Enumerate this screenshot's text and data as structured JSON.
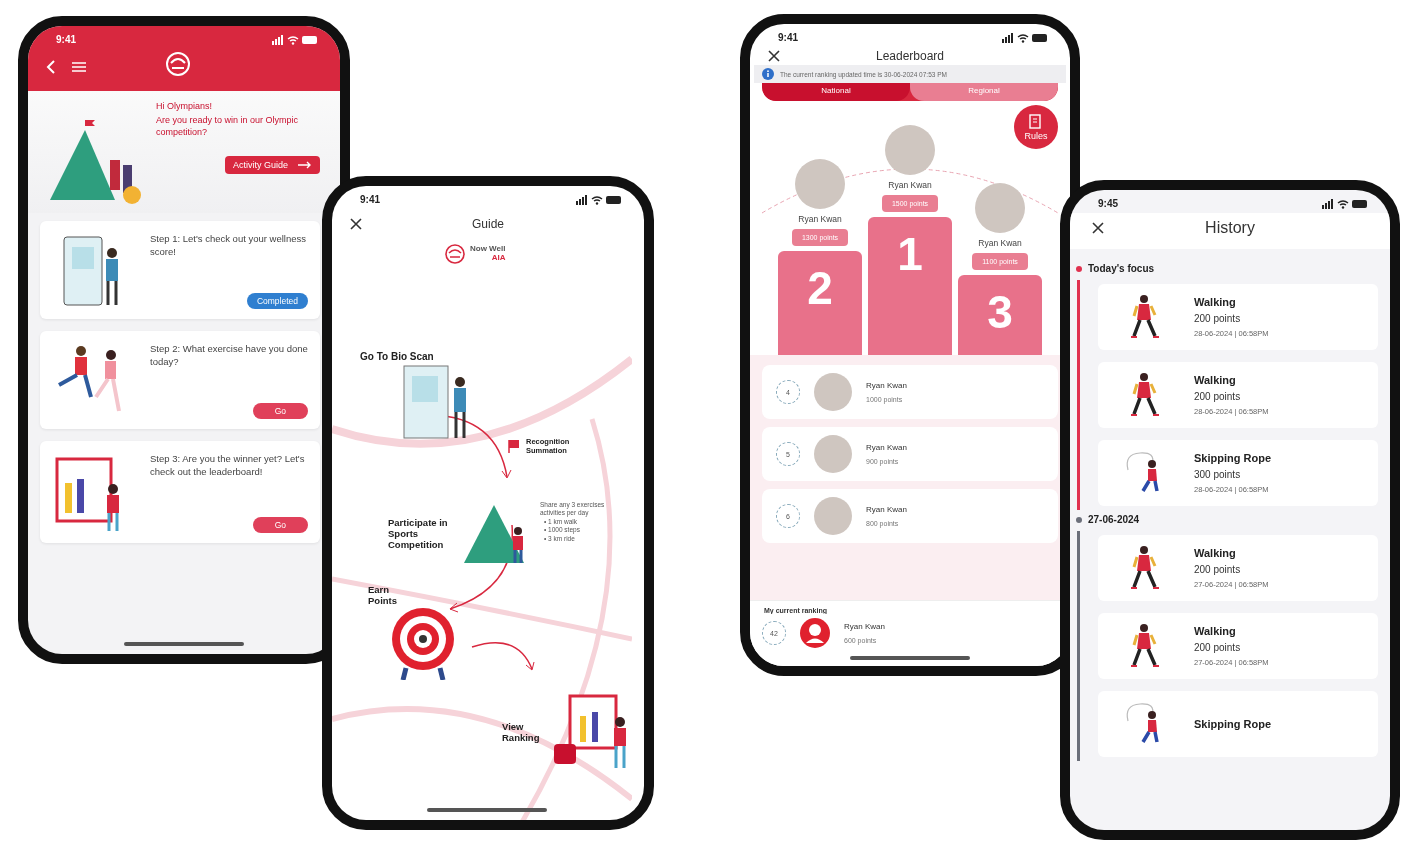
{
  "home": {
    "time": "9:41",
    "greeting": "Hi Olympians!",
    "prompt": "Are you ready to win in our Olympic competition?",
    "guide_button": "Activity Guide",
    "steps": [
      {
        "text": "Step 1: Let's check out your wellness score!",
        "button": "Completed",
        "completed": true,
        "kind": "scan"
      },
      {
        "text": "Step 2: What exercise have you done today?",
        "button": "Go",
        "completed": false,
        "kind": "run"
      },
      {
        "text": "Step 3: Are you the winner yet? Let's check out the leaderboard!",
        "button": "Go",
        "completed": false,
        "kind": "board"
      }
    ]
  },
  "guide": {
    "time": "9:41",
    "title": "Guide",
    "logo_text": "Now Well",
    "logo_sub": "AIA",
    "stages": [
      {
        "label": "Go To Bio Scan",
        "kind": "scan"
      },
      {
        "label": "Recognition Summation",
        "kind": "flag"
      },
      {
        "label": "Participate in Sports Competition",
        "kind": "mountain"
      },
      {
        "label": "Earn Points",
        "kind": "target"
      },
      {
        "label": "View Ranking",
        "kind": "board"
      }
    ],
    "note": {
      "text": "Share any 3 exercises activities per day",
      "bullets": [
        "• 1 km walk",
        "• 1000 steps",
        "• 3 km ride"
      ]
    }
  },
  "leaderboard": {
    "time": "9:41",
    "title": "Leaderboard",
    "info": "The current ranking updated time is 30-06-2024 07:53 PM",
    "tabs": [
      {
        "label": "National",
        "selected": true
      },
      {
        "label": "Regional",
        "selected": false
      }
    ],
    "rules_button": "Rules",
    "podium": [
      {
        "rank": "2",
        "name": "Ryan Kwan",
        "points": "1300 points"
      },
      {
        "rank": "1",
        "name": "Ryan Kwan",
        "points": "1500 points"
      },
      {
        "rank": "3",
        "name": "Ryan Kwan",
        "points": "1100 points"
      }
    ],
    "list": [
      {
        "rank": "4",
        "name": "Ryan Kwan",
        "points": "1000 points"
      },
      {
        "rank": "5",
        "name": "Ryan Kwan",
        "points": "900 points"
      },
      {
        "rank": "6",
        "name": "Ryan Kwan",
        "points": "800 points"
      }
    ],
    "mine": {
      "label": "My current ranking",
      "rank": "42",
      "name": "Ryan Kwan",
      "points": "600 points"
    }
  },
  "history": {
    "time": "9:45",
    "title": "History",
    "groups": [
      {
        "label": "Today's focus",
        "color": "#e0314f",
        "items": [
          {
            "kind": "walking",
            "name": "Walking",
            "points": "200 points",
            "when": "28-06-2024 | 06:58PM"
          },
          {
            "kind": "walking",
            "name": "Walking",
            "points": "200 points",
            "when": "28-06-2024 | 06:58PM"
          },
          {
            "kind": "skipping",
            "name": "Skipping Rope",
            "points": "300 points",
            "when": "28-06-2024 | 06:58PM"
          }
        ]
      },
      {
        "label": "27-06-2024",
        "color": "#6b6f7a",
        "items": [
          {
            "kind": "walking",
            "name": "Walking",
            "points": "200 points",
            "when": "27-06-2024 | 06:58PM"
          },
          {
            "kind": "walking",
            "name": "Walking",
            "points": "200 points",
            "when": "27-06-2024 | 06:58PM"
          },
          {
            "kind": "skipping",
            "name": "Skipping Rope"
          }
        ]
      }
    ]
  }
}
